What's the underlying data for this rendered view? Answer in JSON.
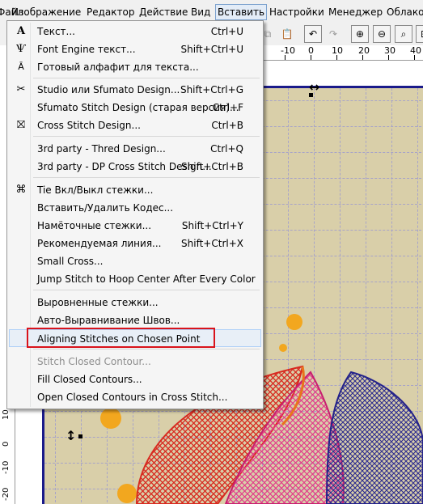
{
  "menubar": {
    "items": [
      "Файл",
      "Изображение",
      "Редактор",
      "Действие",
      "Вид",
      "Вставить",
      "Настройки",
      "Менеджер",
      "Облако"
    ],
    "active_index": 5
  },
  "ruler_top": {
    "ticks": [
      "-10",
      "0",
      "10",
      "20",
      "30",
      "40"
    ]
  },
  "ruler_left": {
    "ticks": [
      "10",
      "0",
      "-10",
      "-20"
    ]
  },
  "menu": {
    "items": [
      {
        "label": "Текст...",
        "shortcut": "Ctrl+U",
        "icon": "text-icon"
      },
      {
        "label": "Font Engine текст...",
        "shortcut": "Shift+Ctrl+U",
        "icon": "font-engine-icon"
      },
      {
        "label": "Готовый алфафит для текста...",
        "shortcut": "",
        "icon": "ready-alphabet-icon"
      },
      {
        "label": "Studio или Sfumato Design...",
        "shortcut": "Shift+Ctrl+G",
        "icon": "studio-icon"
      },
      {
        "label": "Sfumato Stitch Design (старая версия)...",
        "shortcut": "Ctrl+F",
        "icon": ""
      },
      {
        "label": "Cross Stitch Design...",
        "shortcut": "Ctrl+B",
        "icon": "cross-stitch-icon"
      },
      {
        "label": "3rd party - Thred Design...",
        "shortcut": "Ctrl+Q",
        "icon": ""
      },
      {
        "label": "3rd party - DP Cross Stitch Design...",
        "shortcut": "Shift+Ctrl+B",
        "icon": ""
      },
      {
        "label": "Tie Вкл/Выкл стежки...",
        "shortcut": "",
        "icon": "tie-icon"
      },
      {
        "label": "Вставить/Удалить Кодес...",
        "shortcut": "",
        "icon": ""
      },
      {
        "label": "Намёточные стежки...",
        "shortcut": "Shift+Ctrl+Y",
        "icon": ""
      },
      {
        "label": "Рекомендуемая линия...",
        "shortcut": "Shift+Ctrl+X",
        "icon": ""
      },
      {
        "label": "Small Cross...",
        "shortcut": "",
        "icon": ""
      },
      {
        "label": "Jump Stitch to Hoop Center After Every Color",
        "shortcut": "",
        "icon": ""
      },
      {
        "label": "Выровненные стежки...",
        "shortcut": "",
        "icon": ""
      },
      {
        "label": "Авто-Выравнивание Швов...",
        "shortcut": "",
        "icon": ""
      },
      {
        "label": "Aligning Stitches on Chosen Point",
        "shortcut": "",
        "icon": ""
      },
      {
        "label": "Stitch Closed Contour...",
        "shortcut": "",
        "icon": ""
      },
      {
        "label": "Fill Closed Contours...",
        "shortcut": "",
        "icon": ""
      },
      {
        "label": "Open Closed Contours in Cross Stitch...",
        "shortcut": "",
        "icon": ""
      }
    ]
  },
  "colors": {
    "hoop_border": "#1a1a8a",
    "fabric": "#d9cfa9",
    "highlight_box": "#d9131b"
  }
}
